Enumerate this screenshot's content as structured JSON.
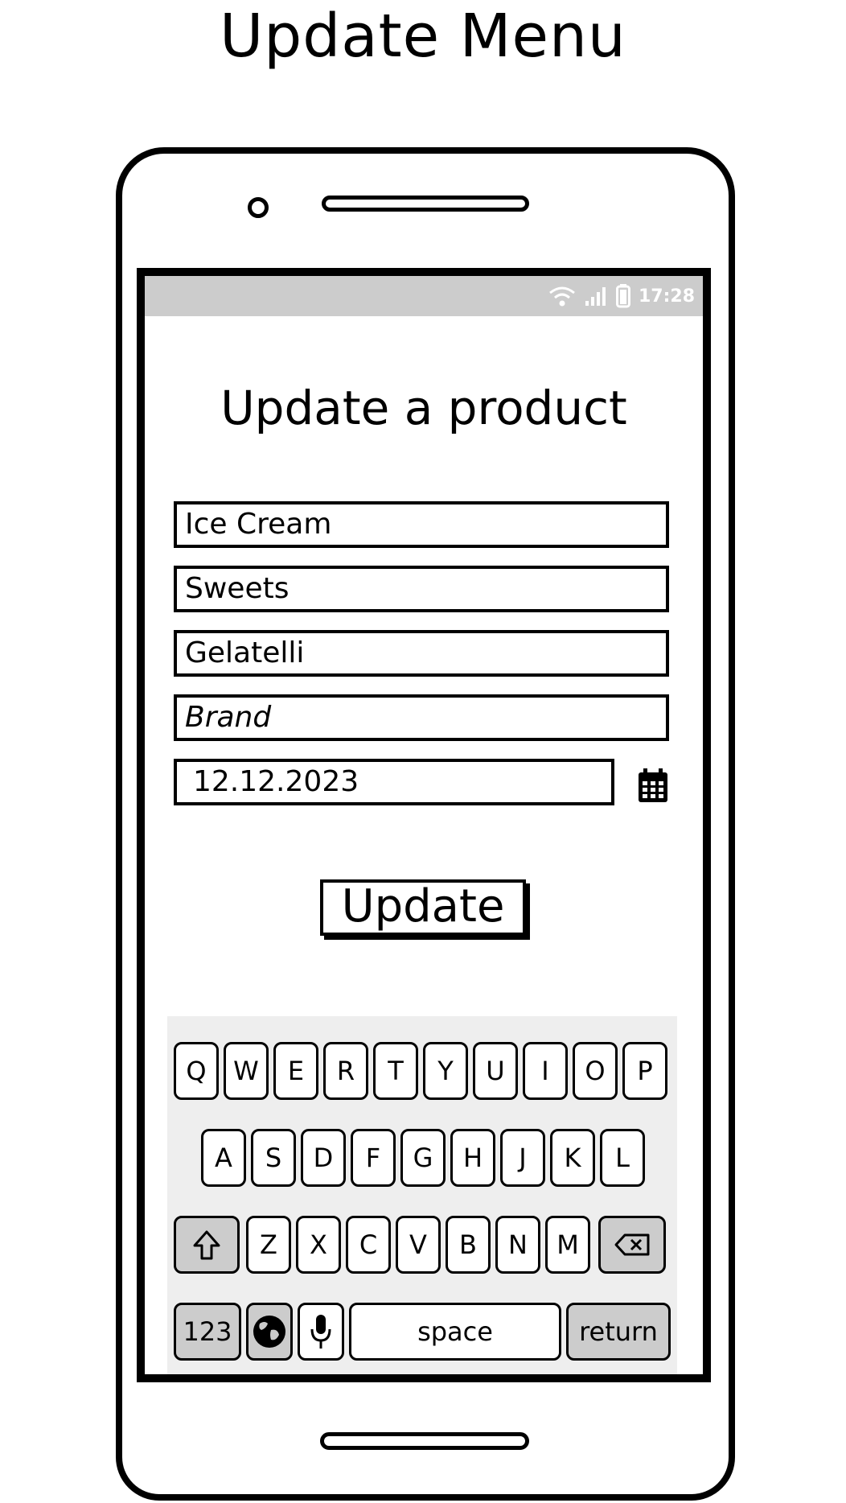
{
  "page": {
    "title": "Update Menu"
  },
  "status_bar": {
    "time": "17:28",
    "icons": [
      "wifi-icon",
      "signal-icon",
      "battery-icon"
    ]
  },
  "form": {
    "title": "Update a product",
    "fields": [
      {
        "value": "Ice Cream"
      },
      {
        "value": "Sweets"
      },
      {
        "value": "Gelatelli"
      },
      {
        "placeholder": "Brand"
      },
      {
        "value": "12.12.2023"
      }
    ],
    "calendar_icon": "calendar-icon",
    "update_button": "Update"
  },
  "keyboard": {
    "row1": [
      "Q",
      "W",
      "E",
      "R",
      "T",
      "Y",
      "U",
      "I",
      "O",
      "P"
    ],
    "row2": [
      "A",
      "S",
      "D",
      "F",
      "G",
      "H",
      "J",
      "K",
      "L"
    ],
    "row3": [
      "Z",
      "X",
      "C",
      "V",
      "B",
      "N",
      "M"
    ],
    "shift_icon": "shift-icon",
    "backspace_icon": "backspace-icon",
    "numbers": "123",
    "globe_icon": "globe-icon",
    "mic_icon": "microphone-icon",
    "space": "space",
    "return": "return"
  },
  "colors": {
    "status_bar": "#cccccc",
    "keyboard_bg": "#eeeeee",
    "special_key": "#cccccc"
  }
}
